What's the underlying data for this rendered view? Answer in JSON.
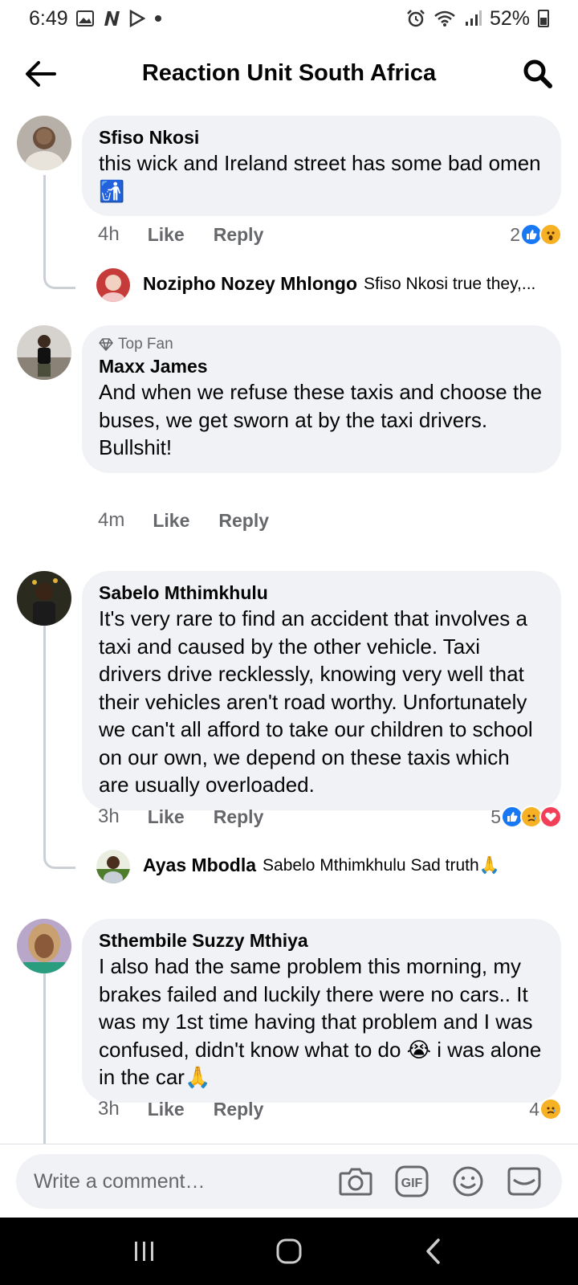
{
  "status_bar": {
    "time": "6:49",
    "battery": "52%",
    "icons_left": [
      "gallery-icon",
      "n-app-icon",
      "play-store-icon",
      "dot-icon"
    ],
    "icons_right": [
      "alarm-icon",
      "wifi-icon",
      "signal-icon",
      "battery-icon"
    ]
  },
  "header": {
    "title": "Reaction Unit South Africa"
  },
  "comments": [
    {
      "author": "Sfiso Nkosi",
      "text": "this wick and Ireland street has some bad omen🚮",
      "time": "4h",
      "like_label": "Like",
      "reply_label": "Reply",
      "reaction_count": "2",
      "reactions": [
        "like",
        "wow"
      ],
      "reply": {
        "author": "Nozipho Nozey Mhlongo",
        "text": "Sfiso Nkosi true they,..."
      }
    },
    {
      "badge": "Top Fan",
      "author": "Maxx James",
      "text": "And when we refuse these taxis and choose the buses, we get sworn at by the taxi drivers.\nBullshit!",
      "time": "4m",
      "like_label": "Like",
      "reply_label": "Reply"
    },
    {
      "author": "Sabelo Mthimkhulu",
      "text": "It's very rare to find an accident that involves a taxi and caused by the other vehicle. Taxi drivers drive recklessly, knowing very well that their vehicles aren't road worthy. Unfortunately we can't all afford to take our children to school on our own, we depend on these taxis which are usually overloaded.",
      "time": "3h",
      "like_label": "Like",
      "reply_label": "Reply",
      "reaction_count": "5",
      "reactions": [
        "like",
        "sad",
        "love"
      ],
      "reply": {
        "author": "Ayas Mbodla",
        "text": "Sabelo Mthimkhulu Sad truth🙏"
      }
    },
    {
      "author": "Sthembile Suzzy Mthiya",
      "text": "I also had the same problem this morning, my brakes failed and luckily there were no cars.. It was my 1st time having that problem and I was confused, didn't know what to do 😭 i was alone in the car🙏",
      "time": "3h",
      "like_label": "Like",
      "reply_label": "Reply",
      "reaction_count": "4",
      "reactions": [
        "sad"
      ]
    }
  ],
  "composer": {
    "placeholder": "Write a comment…",
    "icons": [
      "camera-icon",
      "gif-icon",
      "emoji-icon",
      "sticker-icon"
    ]
  },
  "colors": {
    "bubble": "#f0f2f5",
    "secondary_text": "#65676b",
    "like_blue": "#1877f2",
    "love_red": "#f33e58",
    "reaction_yellow": "#f7b125"
  }
}
